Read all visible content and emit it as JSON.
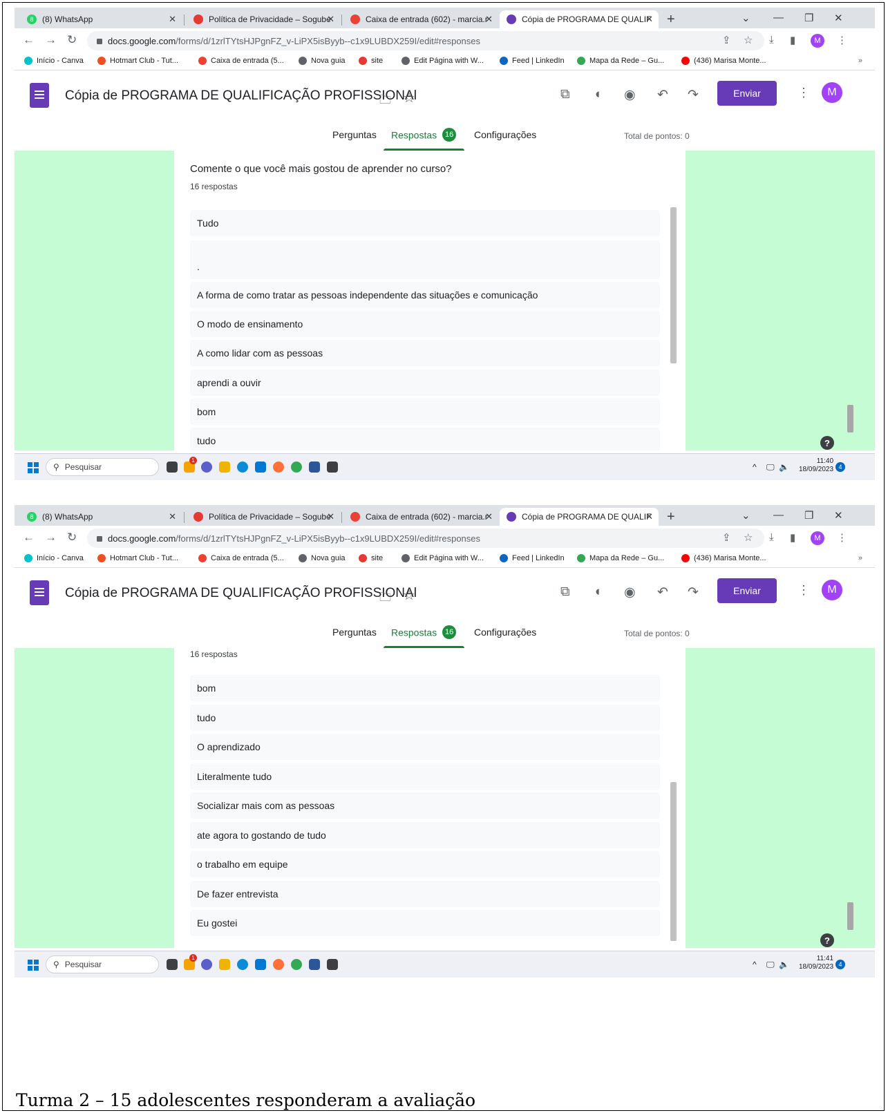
{
  "browser": {
    "tabs": [
      {
        "label": "(8) WhatsApp",
        "icon": "whatsapp-icon",
        "color": "#25d366"
      },
      {
        "label": "Política de Privacidade – Sogube",
        "icon": "heart-icon",
        "color": "#e53935"
      },
      {
        "label": "Caixa de entrada (602) - marcia.r",
        "icon": "gmail-icon",
        "color": "#ea4335"
      },
      {
        "label": "Cópia de PROGRAMA DE QUALIF",
        "icon": "forms-icon",
        "color": "#673ab7"
      }
    ],
    "whatsapp_count": "8",
    "url_domain": "docs.google.com",
    "url_path": "/forms/d/1zrlTYtsHJPgnFZ_v-LiPX5isByyb--c1x9LUBDX259I/edit#responses",
    "profile_initial": "M",
    "bookmarks": [
      {
        "label": "Início - Canva",
        "icon": "canva-icon",
        "color": "#00c4cc"
      },
      {
        "label": "Hotmart Club - Tut...",
        "icon": "hotmart-icon",
        "color": "#f04e23"
      },
      {
        "label": "Caixa de entrada (5...",
        "icon": "gmail-icon",
        "color": "#ea4335"
      },
      {
        "label": "Nova guia",
        "icon": "globe-icon",
        "color": "#5f6368"
      },
      {
        "label": "site",
        "icon": "heart-icon",
        "color": "#e53935"
      },
      {
        "label": "Edit Página with W...",
        "icon": "globe-icon",
        "color": "#5f6368"
      },
      {
        "label": "Feed | LinkedIn",
        "icon": "linkedin-icon",
        "color": "#0a66c2"
      },
      {
        "label": "Mapa da Rede – Gu...",
        "icon": "network-icon",
        "color": "#34a853"
      },
      {
        "label": "(436) Marisa Monte...",
        "icon": "youtube-icon",
        "color": "#ff0000"
      }
    ],
    "bookmarks_more": "»"
  },
  "form": {
    "title": "Cópia de PROGRAMA DE QUALIFICAÇÃO PROFISSIONAl",
    "send_label": "Enviar",
    "avatar_initial": "M",
    "tabs": {
      "questions": "Perguntas",
      "responses": "Respostas",
      "responses_count": "16",
      "settings": "Configurações"
    },
    "total_points": "Total de pontos: 0",
    "accent_color": "#673ab7",
    "background_color": "#c6fcd4"
  },
  "shot1": {
    "question": "Comente o que você mais gostou de aprender no curso?",
    "response_count": "16 respostas",
    "responses": [
      "Tudo",
      ".",
      "A forma de como tratar as pessoas independente das situações e comunicação",
      "O modo de ensinamento",
      "A como lidar com as pessoas",
      "aprendi a ouvir",
      "bom",
      "tudo"
    ],
    "time": "11:40",
    "date": "18/09/2023"
  },
  "shot2": {
    "response_count": "16 respostas",
    "responses": [
      "bom",
      "tudo",
      "O aprendizado",
      "Literalmente tudo",
      "Socializar mais com as pessoas",
      "ate agora to gostando de tudo",
      "o trabalho em equipe",
      "De fazer entrevista",
      "Eu gostei"
    ],
    "time": "11:41",
    "date": "18/09/2023"
  },
  "taskbar": {
    "search_label": "Pesquisar",
    "notification_count": "4",
    "badge_count": "1"
  },
  "caption": "Turma 2 – 15 adolescentes responderam a avaliação"
}
